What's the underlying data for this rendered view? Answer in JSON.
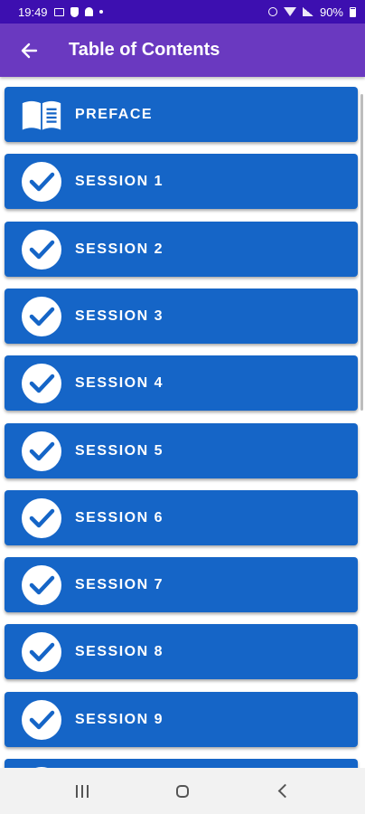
{
  "status_bar": {
    "time": "19:49",
    "battery": "90%"
  },
  "app_bar": {
    "title": "Table of Contents"
  },
  "toc": {
    "items": [
      {
        "label": "PREFACE",
        "icon": "book-icon"
      },
      {
        "label": "SESSION 1",
        "icon": "check-circle-icon"
      },
      {
        "label": "SESSION 2",
        "icon": "check-circle-icon"
      },
      {
        "label": "SESSION 3",
        "icon": "check-circle-icon"
      },
      {
        "label": "SESSION 4",
        "icon": "check-circle-icon"
      },
      {
        "label": "SESSION 5",
        "icon": "check-circle-icon"
      },
      {
        "label": "SESSION 6",
        "icon": "check-circle-icon"
      },
      {
        "label": "SESSION 7",
        "icon": "check-circle-icon"
      },
      {
        "label": "SESSION 8",
        "icon": "check-circle-icon"
      },
      {
        "label": "SESSION 9",
        "icon": "check-circle-icon"
      },
      {
        "label": "",
        "icon": "check-circle-icon"
      }
    ]
  },
  "colors": {
    "status_bar": "#3d0fb0",
    "app_bar": "#6a39c0",
    "item_background": "#1565c7",
    "nav_bar": "#f2f2f2"
  }
}
